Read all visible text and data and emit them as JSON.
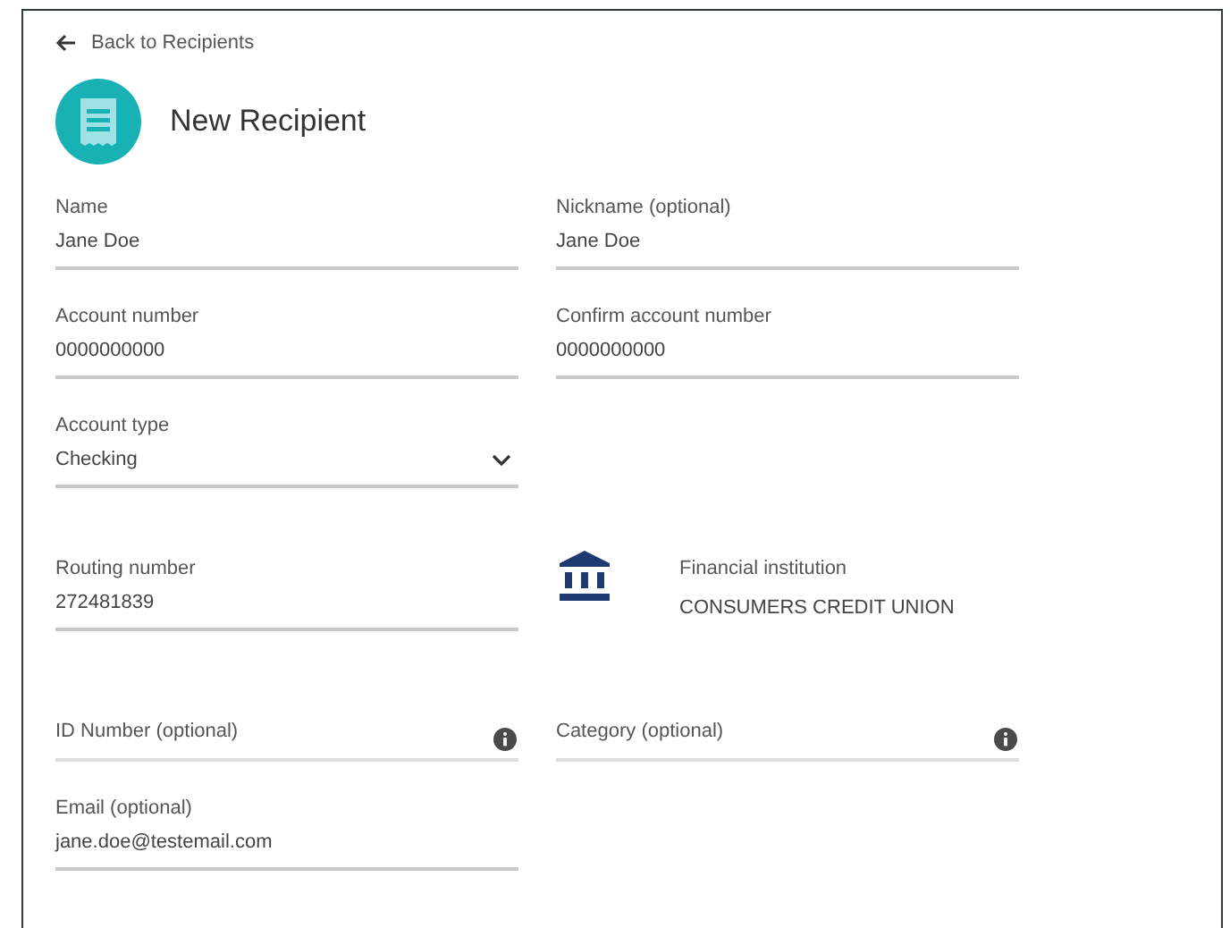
{
  "back_link": "Back to Recipients",
  "title": "New Recipient",
  "rows": [
    [
      {
        "kind": "text",
        "label": "Name",
        "value": "Jane Doe"
      },
      {
        "kind": "text",
        "label": "Nickname (optional)",
        "value": "Jane Doe"
      }
    ],
    [
      {
        "kind": "text",
        "label": "Account number",
        "value": "0000000000"
      },
      {
        "kind": "text",
        "label": "Confirm account number",
        "value": "0000000000"
      }
    ],
    [
      {
        "kind": "select",
        "label": "Account type",
        "value": "Checking"
      }
    ],
    [
      {
        "kind": "text",
        "label": "Routing number",
        "value": "272481839"
      },
      {
        "kind": "institution",
        "label": "Financial institution",
        "value": "CONSUMERS CREDIT UNION"
      }
    ],
    [
      {
        "kind": "info",
        "label": "ID Number (optional)"
      },
      {
        "kind": "info",
        "label": "Category (optional)"
      }
    ],
    [
      {
        "kind": "text",
        "label": "Email (optional)",
        "value": "jane.doe@testemail.com"
      }
    ]
  ]
}
